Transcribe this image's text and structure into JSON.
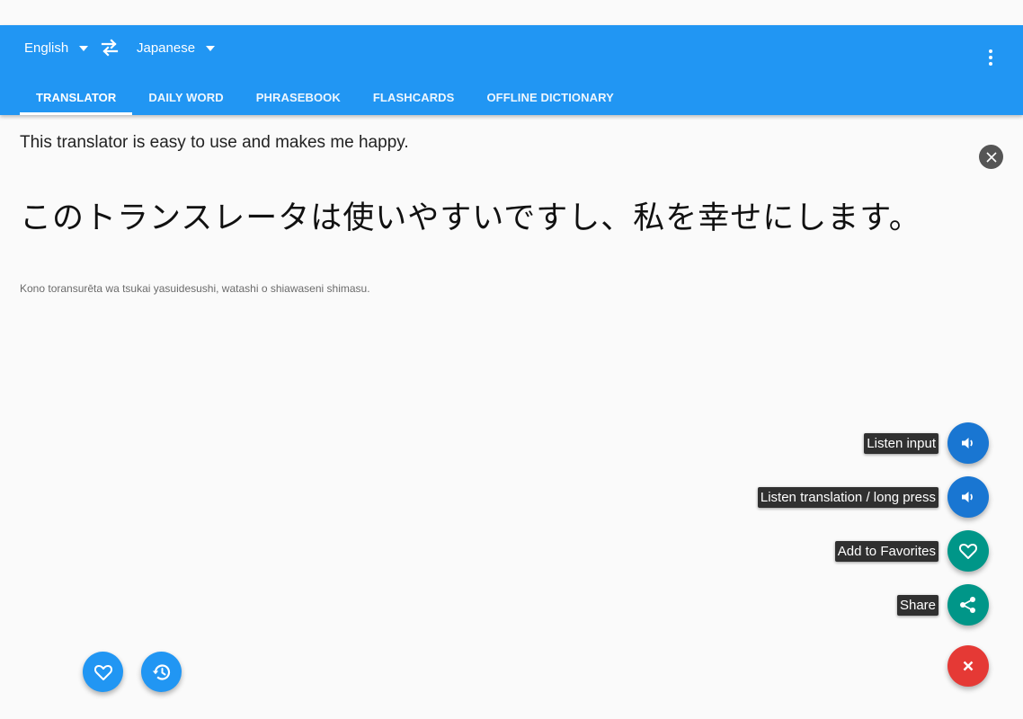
{
  "header": {
    "source_language": "English",
    "target_language": "Japanese",
    "icons": {
      "swap": "swap-arrows-icon",
      "overflow": "more-vert-icon"
    }
  },
  "tabs": [
    {
      "label": "TRANSLATOR",
      "active": true
    },
    {
      "label": "DAILY WORD",
      "active": false
    },
    {
      "label": "PHRASEBOOK",
      "active": false
    },
    {
      "label": "FLASHCARDS",
      "active": false
    },
    {
      "label": "OFFLINE DICTIONARY",
      "active": false
    }
  ],
  "translator": {
    "input_text": "This translator is easy to use and makes me happy.",
    "translation": "このトランスレータは使いやすいですし、私を幸せにします。",
    "transliteration": "Kono toransurēta wa tsukai yasuidesushi, watashi o shiawaseni shimasu."
  },
  "actions": [
    {
      "label": "Listen input",
      "icon": "volume-icon",
      "color": "#1976d2"
    },
    {
      "label": "Listen translation / long press",
      "icon": "volume-icon",
      "color": "#1976d2"
    },
    {
      "label": "Add to Favorites",
      "icon": "heart-outline-icon",
      "color": "#009688"
    },
    {
      "label": "Share",
      "icon": "share-icon",
      "color": "#009688"
    }
  ],
  "colors": {
    "primary": "#2196f3",
    "fab_blue": "#1976d2",
    "fab_teal": "#009688",
    "fab_red": "#e53935"
  }
}
